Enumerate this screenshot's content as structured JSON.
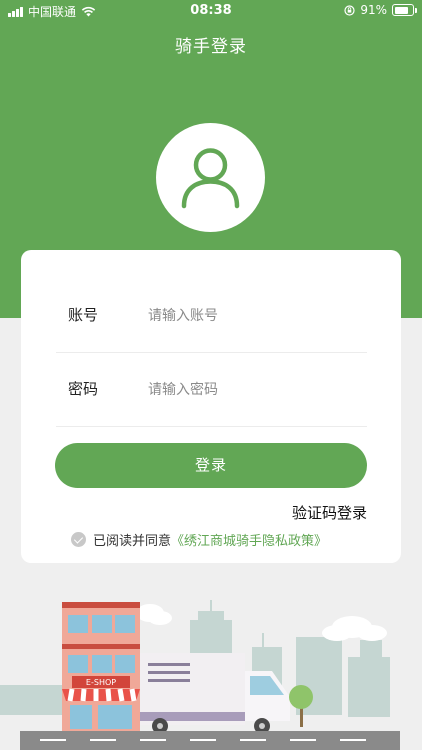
{
  "status_bar": {
    "carrier": "中国联通",
    "time": "08:38",
    "battery": "91%"
  },
  "header": {
    "title": "骑手登录"
  },
  "form": {
    "account_label": "账号",
    "account_placeholder": "请输入账号",
    "password_label": "密码",
    "password_placeholder": "请输入密码",
    "login_button": "登录",
    "sms_login_link": "验证码登录"
  },
  "agreement": {
    "prefix": "已阅读并同意",
    "policy_link": "《绣江商城骑手隐私政策》"
  },
  "illustration": {
    "shop_sign": "E-SHOP"
  },
  "colors": {
    "brand_green": "#62a755",
    "background": "#efefef"
  }
}
